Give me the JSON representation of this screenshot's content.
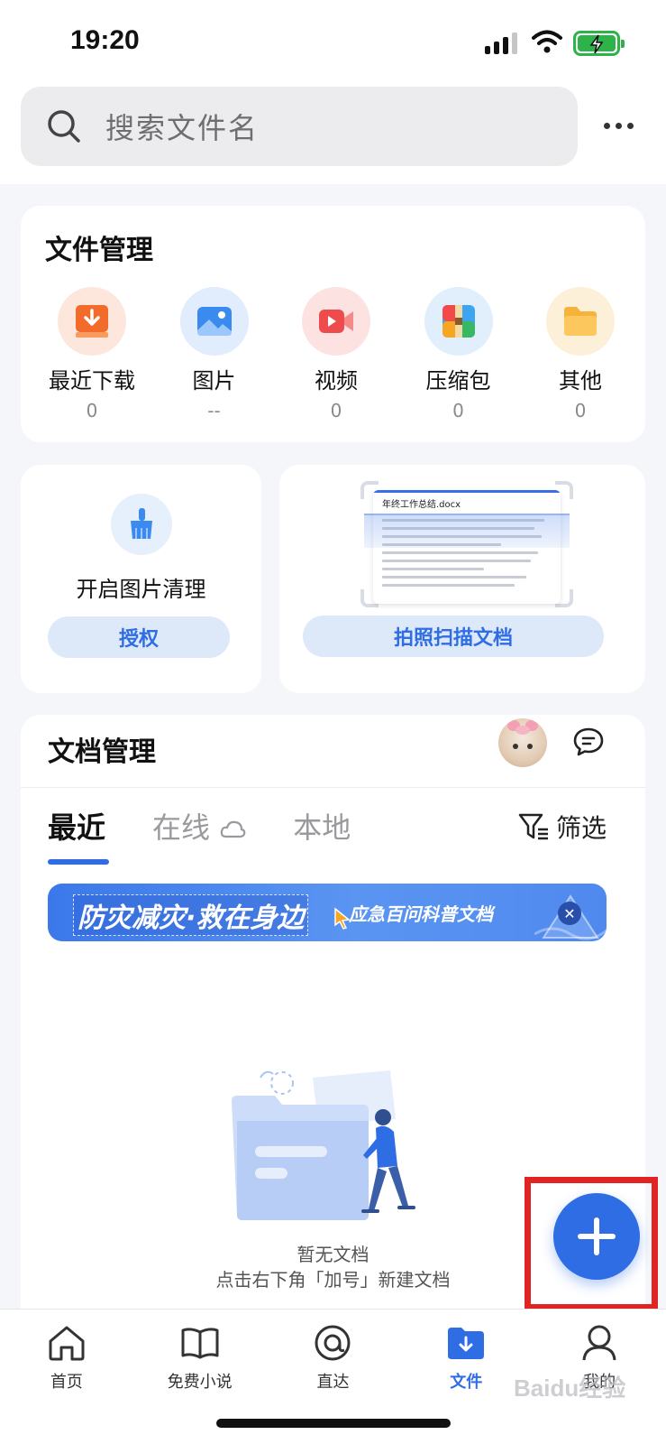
{
  "status_bar": {
    "time": "19:20"
  },
  "search": {
    "placeholder": "搜索文件名"
  },
  "file_management": {
    "title": "文件管理",
    "categories": [
      {
        "label": "最近下载",
        "count": "0",
        "icon": "download-icon",
        "color": "#f26b2b"
      },
      {
        "label": "图片",
        "count": "--",
        "icon": "image-icon",
        "color": "#3a8af0"
      },
      {
        "label": "视频",
        "count": "0",
        "icon": "video-icon",
        "color": "#ee4c4c"
      },
      {
        "label": "压缩包",
        "count": "0",
        "icon": "archive-icon",
        "color": "#3fa4f0"
      },
      {
        "label": "其他",
        "count": "0",
        "icon": "folder-icon",
        "color": "#f7b23b"
      }
    ]
  },
  "image_clean": {
    "text": "开启图片清理",
    "button": "授权"
  },
  "scan_doc": {
    "preview_title": "年终工作总结.docx",
    "button": "拍照扫描文档"
  },
  "doc_management": {
    "title": "文档管理",
    "tabs": [
      "最近",
      "在线",
      "本地"
    ],
    "active_tab": "最近",
    "filter_label": "筛选",
    "banner": {
      "main": "防灾减灾·救在身边",
      "sub": "应急百问科普文档"
    },
    "empty_title": "暂无文档",
    "empty_hint": "点击右下角「加号」新建文档"
  },
  "bottom_nav": {
    "items": [
      {
        "label": "首页",
        "icon": "home-icon"
      },
      {
        "label": "免费小说",
        "icon": "book-icon"
      },
      {
        "label": "直达",
        "icon": "direct-icon"
      },
      {
        "label": "文件",
        "icon": "file-folder-icon"
      },
      {
        "label": "我的",
        "icon": "profile-icon"
      }
    ],
    "active": "文件"
  },
  "watermark": "Baidu经验",
  "colors": {
    "accent": "#2f6de5",
    "highlight_box": "#e02424"
  }
}
